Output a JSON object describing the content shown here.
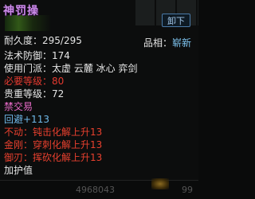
{
  "item": {
    "name": "神罚操",
    "unequip_button": "卸下",
    "durability": "耐久度：295/295",
    "quality_label": "品相：",
    "quality_value": "崭新",
    "magic_defense": "法术防御：174",
    "sects": "使用门派：太虚 云麓 冰心 弈剑",
    "required_level": "必要等级：80",
    "noble_level": "贵重等级：72",
    "trade": "禁交易",
    "dodge": "回避+113",
    "attr1": "不动：钝击化解上升13",
    "attr2": "金刚：穿刺化解上升13",
    "attr3": "御刃：挥砍化解上升13",
    "enchant_label": "加护值"
  },
  "footer": {
    "money": "4968043",
    "slot_cost": "99"
  },
  "colors": {
    "title": "#c98ae6",
    "white": "#e6e6e6",
    "red": "#e43a30",
    "pink": "#e86ac8",
    "blue": "#6fb8e8"
  }
}
